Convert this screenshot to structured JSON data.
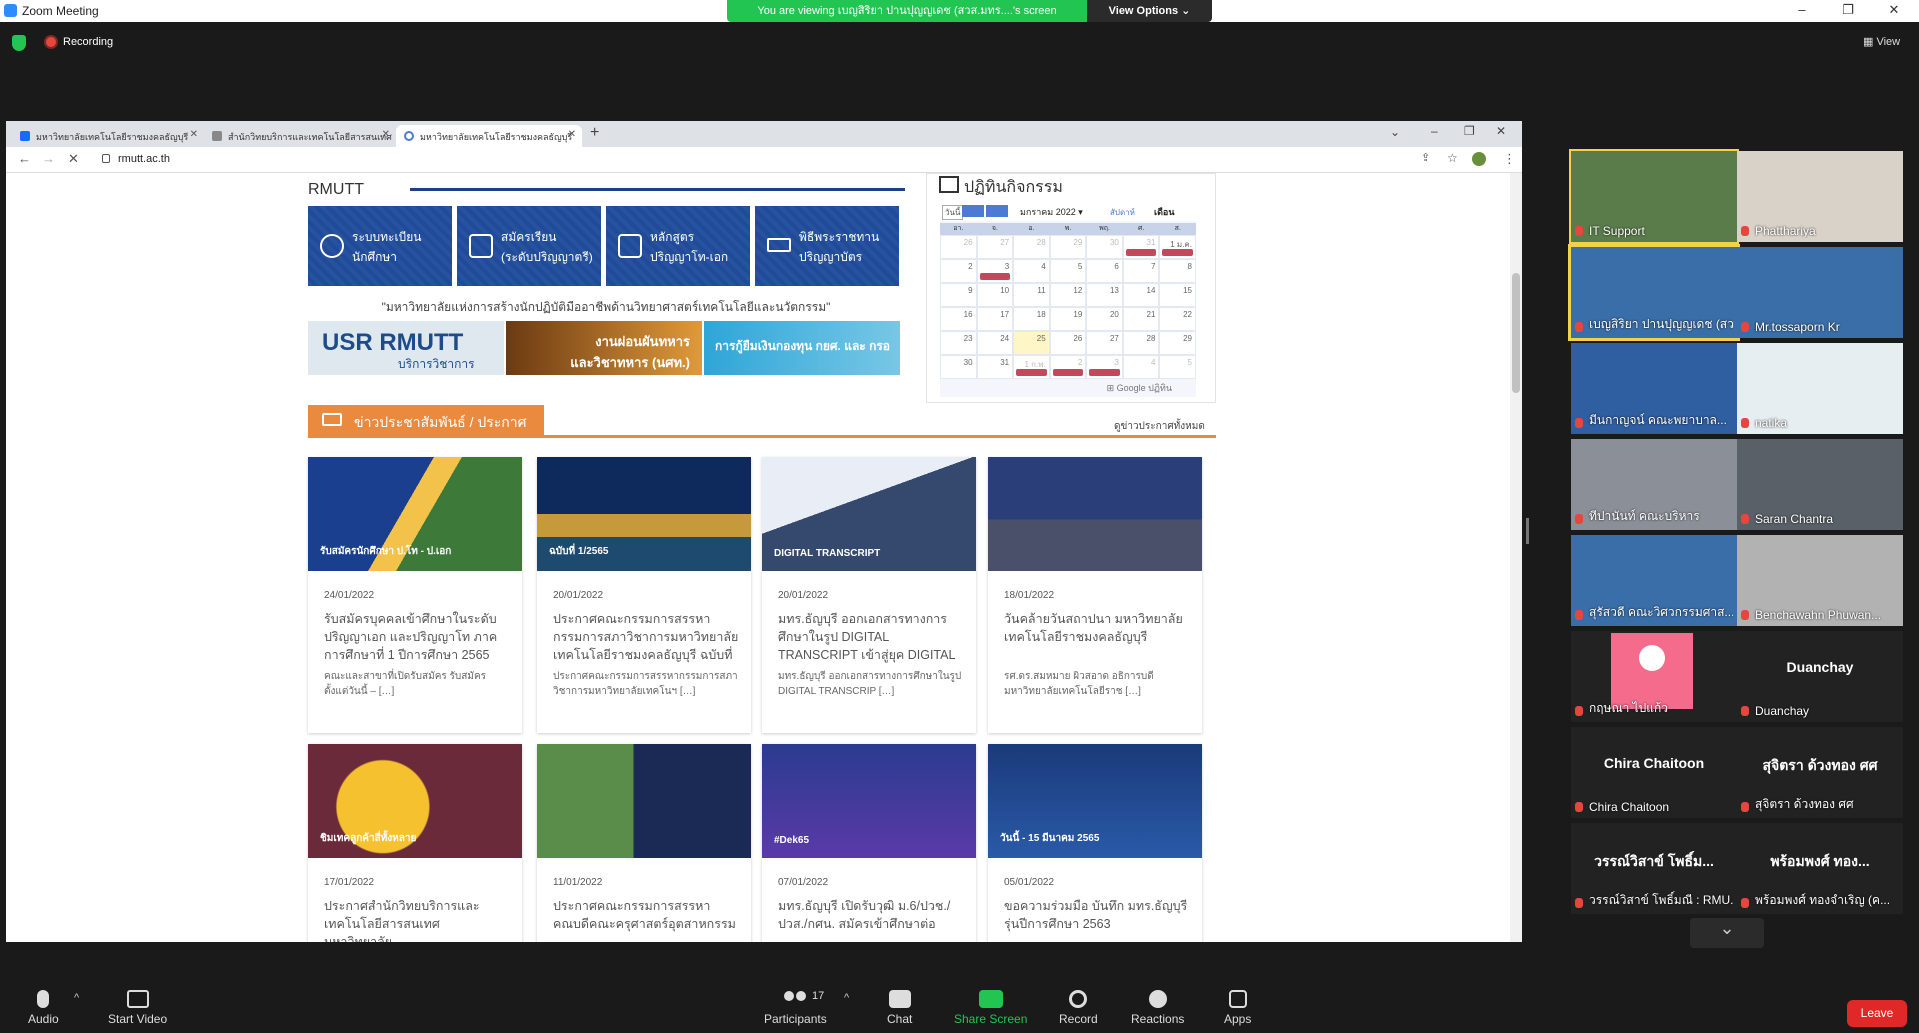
{
  "zoom": {
    "window_title": "Zoom Meeting",
    "banner": "You are viewing เบญสิริยา ปานปุญญเดช (สวส.มทร....'s screen",
    "view_options": "View Options ⌄",
    "recording": "Recording",
    "view": "View"
  },
  "browser": {
    "tabs": [
      {
        "label": "มหาวิทยาลัยเทคโนโลยีราชมงคลธัญบุรี"
      },
      {
        "label": "สำนักวิทยบริการและเทคโนโลยีสารสนเทศ"
      },
      {
        "label": "มหาวิทยาลัยเทคโนโลยีราชมงคลธัญบุรี"
      }
    ],
    "new_tab": "+",
    "url": "rmutt.ac.th"
  },
  "page": {
    "heading": "RMUTT",
    "quick_links": [
      {
        "l1": "ระบบทะเบียน",
        "l2": "นักศึกษา"
      },
      {
        "l1": "สมัครเรียน",
        "l2": "(ระดับปริญญาตรี)"
      },
      {
        "l1": "หลักสูตร",
        "l2": "ปริญญาโท-เอก"
      },
      {
        "l1": "พิธีพระราชทาน",
        "l2": "ปริญญาบัตร"
      }
    ],
    "slogan": "\"มหาวิทยาลัยแห่งการสร้างนักปฏิบัติมืออาชีพด้านวิทยาศาสตร์เทคโนโลยีและนวัตกรรม\"",
    "banners": {
      "usr": "USR RMUTT",
      "usr_sub": "บริการวิชาการ",
      "pension": "งานผ่อนผันทหาร และวิชาทหาร (นศท.)",
      "loan": "การกู้ยืมเงินกองทุน กยศ. และ กรอ"
    },
    "calendar": {
      "title": "ปฏิทินกิจกรรม",
      "today_btn": "วันนี้",
      "month": "มกราคม 2022 ▾",
      "week": "สัปดาห์",
      "month_view": "เดือน",
      "days": [
        "อา.",
        "จ.",
        "อ.",
        "พ.",
        "พฤ.",
        "ศ.",
        "ส."
      ],
      "cells": [
        "26",
        "27",
        "28",
        "29",
        "30",
        "31",
        "1 ม.ค.",
        "2",
        "3",
        "4",
        "5",
        "6",
        "7",
        "8",
        "9",
        "10",
        "11",
        "12",
        "13",
        "14",
        "15",
        "16",
        "17",
        "18",
        "19",
        "20",
        "21",
        "22",
        "23",
        "24",
        "25",
        "26",
        "27",
        "28",
        "29",
        "30",
        "31",
        "1 ก.พ.",
        "2",
        "3",
        "4",
        "5"
      ],
      "footer": "Google ปฏิทิน"
    },
    "news": {
      "title": "ข่าวประชาสัมพันธ์ / ประกาศ",
      "all_link": "ดูข่าวประกาศทั้งหมด",
      "cards": [
        {
          "date": "24/01/2022",
          "title": "รับสมัครบุคคลเข้าศึกษาในระดับปริญญาเอก และปริญญาโท ภาคการศึกษาที่ 1 ปีการศึกษา 2565",
          "desc": "คณะและสาขาที่เปิดรับสมัคร รับสมัครตั้งแต่วันนี้ – […]",
          "img_text": "รับสมัครนักศึกษา ป.โท - ป.เอก"
        },
        {
          "date": "20/01/2022",
          "title": "ประกาศคณะกรรมการสรรหากรรมการสภาวิชาการมหาวิทยาลัยเทคโนโลยีราชมงคลธัญบุรี ฉบับที่",
          "desc": "ประกาศคณะกรรมการสรรหากรรมการสภาวิชาการมหาวิทยาลัยเทคโนฯ […]",
          "img_text": "ฉบับที่ 1/2565"
        },
        {
          "date": "20/01/2022",
          "title": "มทร.ธัญบุรี ออกเอกสารทางการศึกษาในรูป DIGITAL TRANSCRIPT เข้าสู่ยุค DIGITAL",
          "desc": "มทร.ธัญบุรี ออกเอกสารทางการศึกษาในรูป DIGITAL TRANSCRIP […]",
          "img_text": "DIGITAL TRANSCRIPT"
        },
        {
          "date": "18/01/2022",
          "title": "วันคล้ายวันสถาปนา มหาวิทยาลัยเทคโนโลยีราชมงคลธัญบุรี",
          "desc": "รศ.ดร.สมหมาย ผิวสอาด อธิการบดี มหาวิทยาลัยเทคโนโลยีราช […]",
          "img_text": ""
        },
        {
          "date": "17/01/2022",
          "title": "ประกาศสำนักวิทยบริการและเทคโนโลยีสารสนเทศ มหาวิทยาลัย",
          "desc": "",
          "img_text": "ชิมเทคลูกค้าสี่ทั้งหลาย"
        },
        {
          "date": "11/01/2022",
          "title": "ประกาศคณะกรรมการสรรหาคณบดีคณะครุศาสตร์อุตสาหกรรม",
          "desc": "",
          "img_text": ""
        },
        {
          "date": "07/01/2022",
          "title": "มทร.ธัญบุรี เปิดรับวุฒิ ม.6/ปวช./ปวส./กศน. สมัครเข้าศึกษาต่อ",
          "desc": "",
          "img_text": "#Dek65"
        },
        {
          "date": "05/01/2022",
          "title": "ขอความร่วมมือ บันทึก มทร.ธัญบุรี รุ่นปีการศึกษา 2563",
          "desc": "",
          "img_text": "วันนี้ - 15 มีนาคม 2565"
        }
      ]
    }
  },
  "participants": [
    {
      "name": "IT Support",
      "big": ""
    },
    {
      "name": "Phatthariya",
      "big": ""
    },
    {
      "name": "เบญสิริยา ปานปุญญเดช (สว...",
      "big": ""
    },
    {
      "name": "Mr.tossaporn Kr",
      "big": ""
    },
    {
      "name": "มีนกาญจน์ คณะพยาบาล...",
      "big": ""
    },
    {
      "name": "natika",
      "big": ""
    },
    {
      "name": "ทีปานันท์ คณะบริหาร",
      "big": ""
    },
    {
      "name": "Saran Chantra",
      "big": ""
    },
    {
      "name": "สุรัสวดี คณะวิศวกรรมศาส...",
      "big": ""
    },
    {
      "name": "Benchawahn Phuwan...",
      "big": ""
    },
    {
      "name": "กฤษณา ไปแก้ว",
      "big": ""
    },
    {
      "name": "Duanchay",
      "big": "Duanchay"
    },
    {
      "name": "Chira Chaitoon",
      "big": "Chira Chaitoon"
    },
    {
      "name": "สุจิตรา ด้วงทอง ศศ",
      "big": "สุจิตรา ด้วงทอง ศศ"
    },
    {
      "name": "วรรณ์วิสาข์ โพธิ์มณี : RMU...",
      "big": "วรรณ์วิสาข์ โพธิ์ม..."
    },
    {
      "name": "พร้อมพงศ์ ทองจำเริญ (ค...",
      "big": "พร้อมพงศ์ ทอง..."
    }
  ],
  "toolbar": {
    "audio": "Audio",
    "start_video": "Start Video",
    "participants": "Participants",
    "participants_count": "17",
    "chat": "Chat",
    "share_screen": "Share Screen",
    "record": "Record",
    "reactions": "Reactions",
    "apps": "Apps",
    "leave": "Leave"
  }
}
